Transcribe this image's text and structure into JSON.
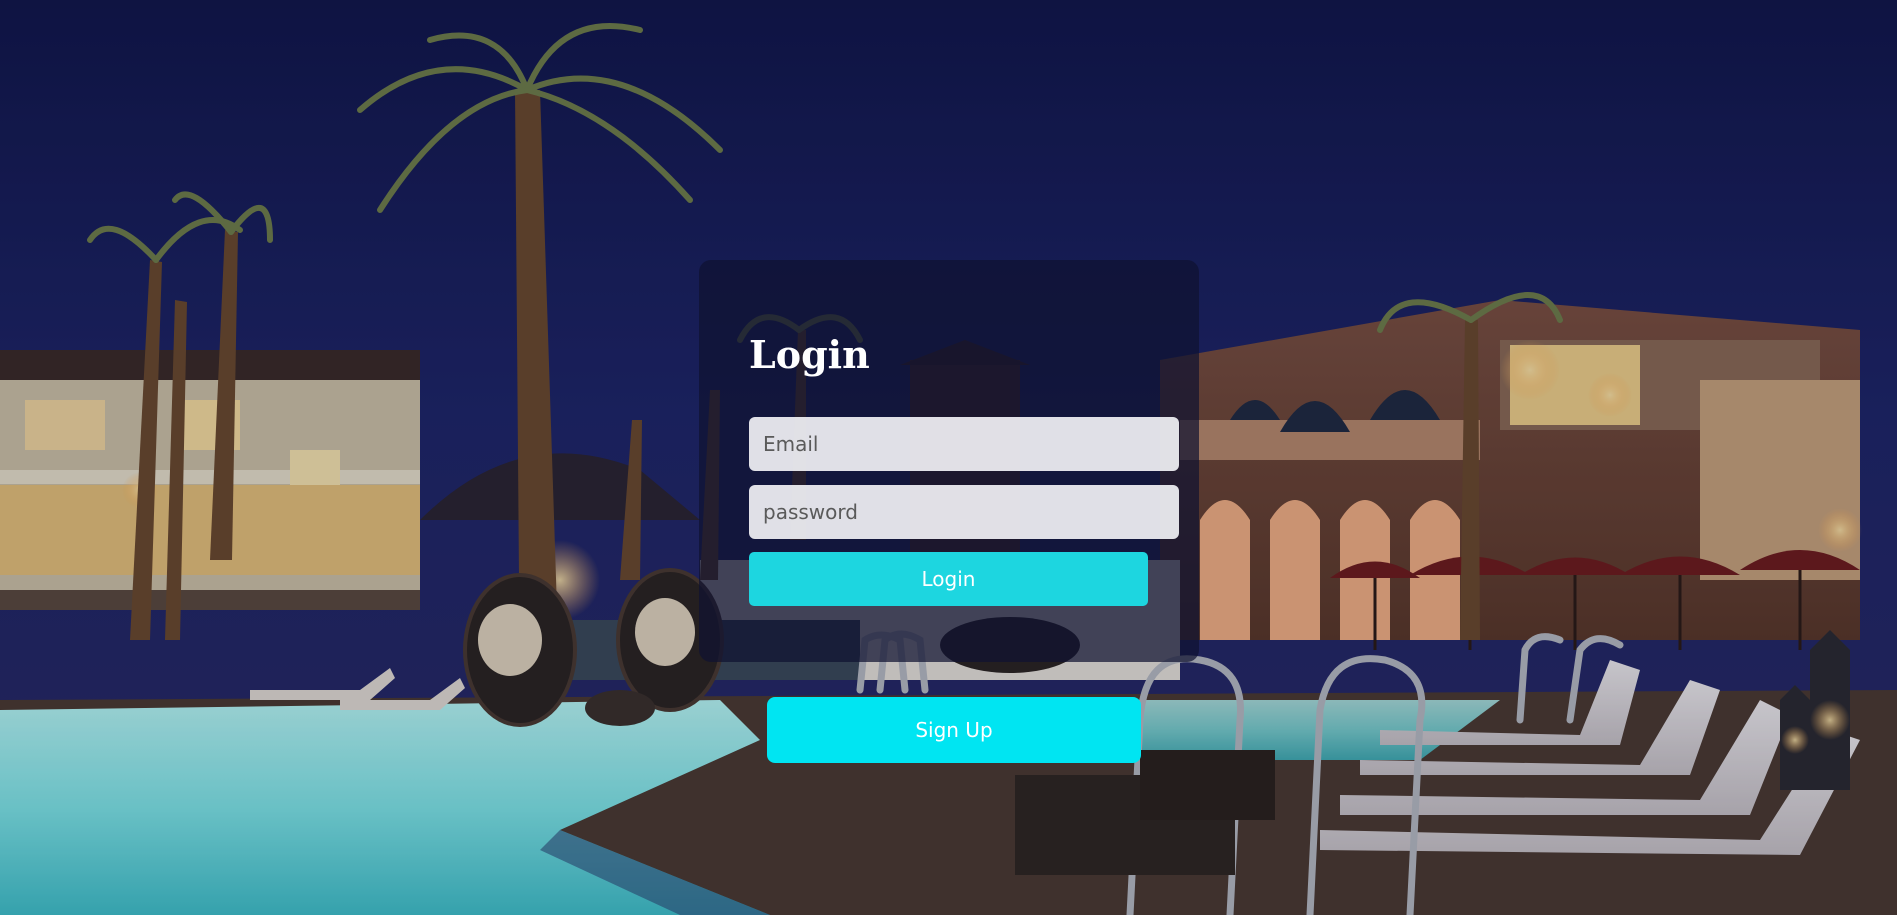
{
  "login_form": {
    "title": "Login",
    "email_placeholder": "Email",
    "password_placeholder": "password",
    "login_label": "Login"
  },
  "signup": {
    "label": "Sign Up"
  },
  "colors": {
    "login_button": "#1dd6e0",
    "signup_button": "#00e5f2",
    "card_overlay": "#0f1230",
    "sky": "#1b2362",
    "pool_water": "#7fe9ea"
  }
}
